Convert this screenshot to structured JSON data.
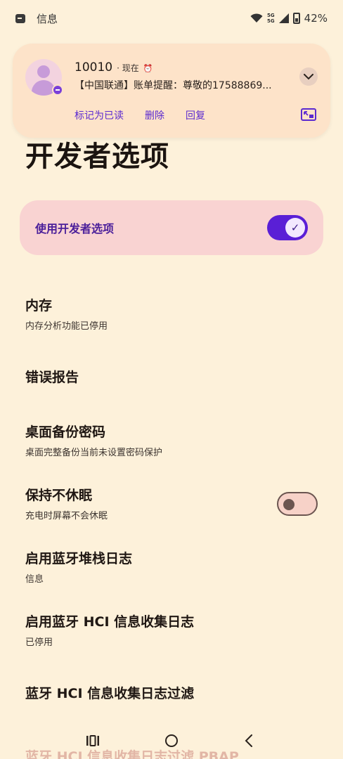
{
  "status_bar": {
    "app_name": "信息",
    "network": "5G",
    "network2": "5G",
    "battery": "42%"
  },
  "notification": {
    "sender": "10010",
    "time": "现在",
    "message": "【中国联通】账单提醒：尊敬的17588869...",
    "actions": [
      "标记为已读",
      "删除",
      "回复"
    ]
  },
  "page": {
    "title": "开发者选项",
    "main_toggle_label": "使用开发者选项",
    "main_toggle_on": true
  },
  "settings": [
    {
      "title": "内存",
      "subtitle": "内存分析功能已停用"
    },
    {
      "title": "错误报告",
      "subtitle": ""
    },
    {
      "title": "桌面备份密码",
      "subtitle": "桌面完整备份当前未设置密码保护"
    },
    {
      "title": "保持不休眠",
      "subtitle": "充电时屏幕不会休眠",
      "switch_on": false
    },
    {
      "title": "启用蓝牙堆栈日志",
      "subtitle": "信息"
    },
    {
      "title": "启用蓝牙 HCI 信息收集日志",
      "subtitle": "已停用"
    },
    {
      "title": "蓝牙 HCI 信息收集日志过滤",
      "subtitle": ""
    },
    {
      "title": "蓝牙 HCI 信息收集日志过滤 PBAP",
      "subtitle": ""
    }
  ],
  "colors": {
    "background": "#fdf1da",
    "accent": "#5a1fd6",
    "card": "#f9d3d2"
  }
}
